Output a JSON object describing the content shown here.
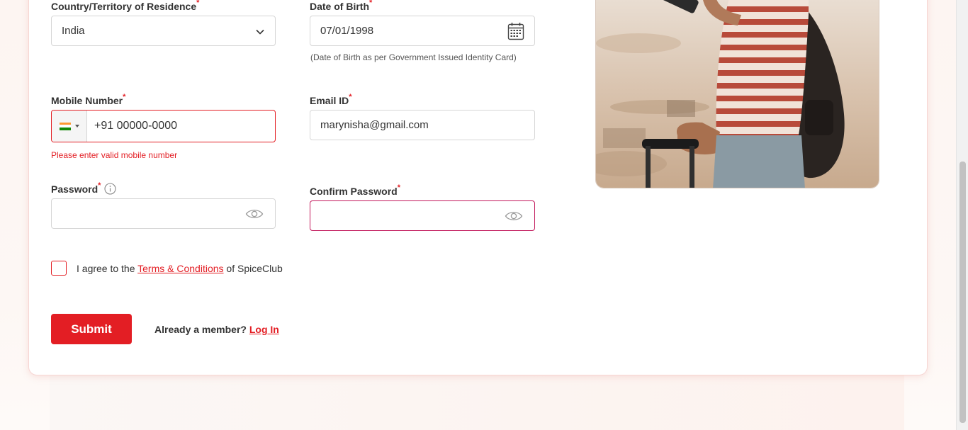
{
  "form": {
    "country": {
      "label": "Country/Territory of Residence",
      "required_mark": "*",
      "value": "India"
    },
    "dob": {
      "label": "Date of Birth",
      "required_mark": "*",
      "value": "07/01/1998",
      "hint": "(Date of Birth as per Government Issued Identity Card)"
    },
    "mobile": {
      "label": "Mobile Number",
      "required_mark": "*",
      "value": "+91 00000-0000",
      "error": "Please enter valid mobile number"
    },
    "email": {
      "label": "Email ID",
      "required_mark": "*",
      "value": "marynisha@gmail.com"
    },
    "password": {
      "label": "Password",
      "required_mark": "*",
      "value": ""
    },
    "confirm_password": {
      "label": "Confirm Password",
      "required_mark": "*",
      "value": ""
    },
    "agree": {
      "prefix": "I agree to the ",
      "link": "Terms & Conditions",
      "suffix": " of SpiceClub"
    },
    "submit_label": "Submit",
    "member_text": "Already a member? ",
    "login_link": "Log In"
  },
  "colors": {
    "accent": "#e31e24",
    "focus_border": "#c2185b"
  },
  "icons": [
    "chevron-down-icon",
    "calendar-icon",
    "india-flag-icon",
    "info-icon",
    "eye-icon"
  ]
}
